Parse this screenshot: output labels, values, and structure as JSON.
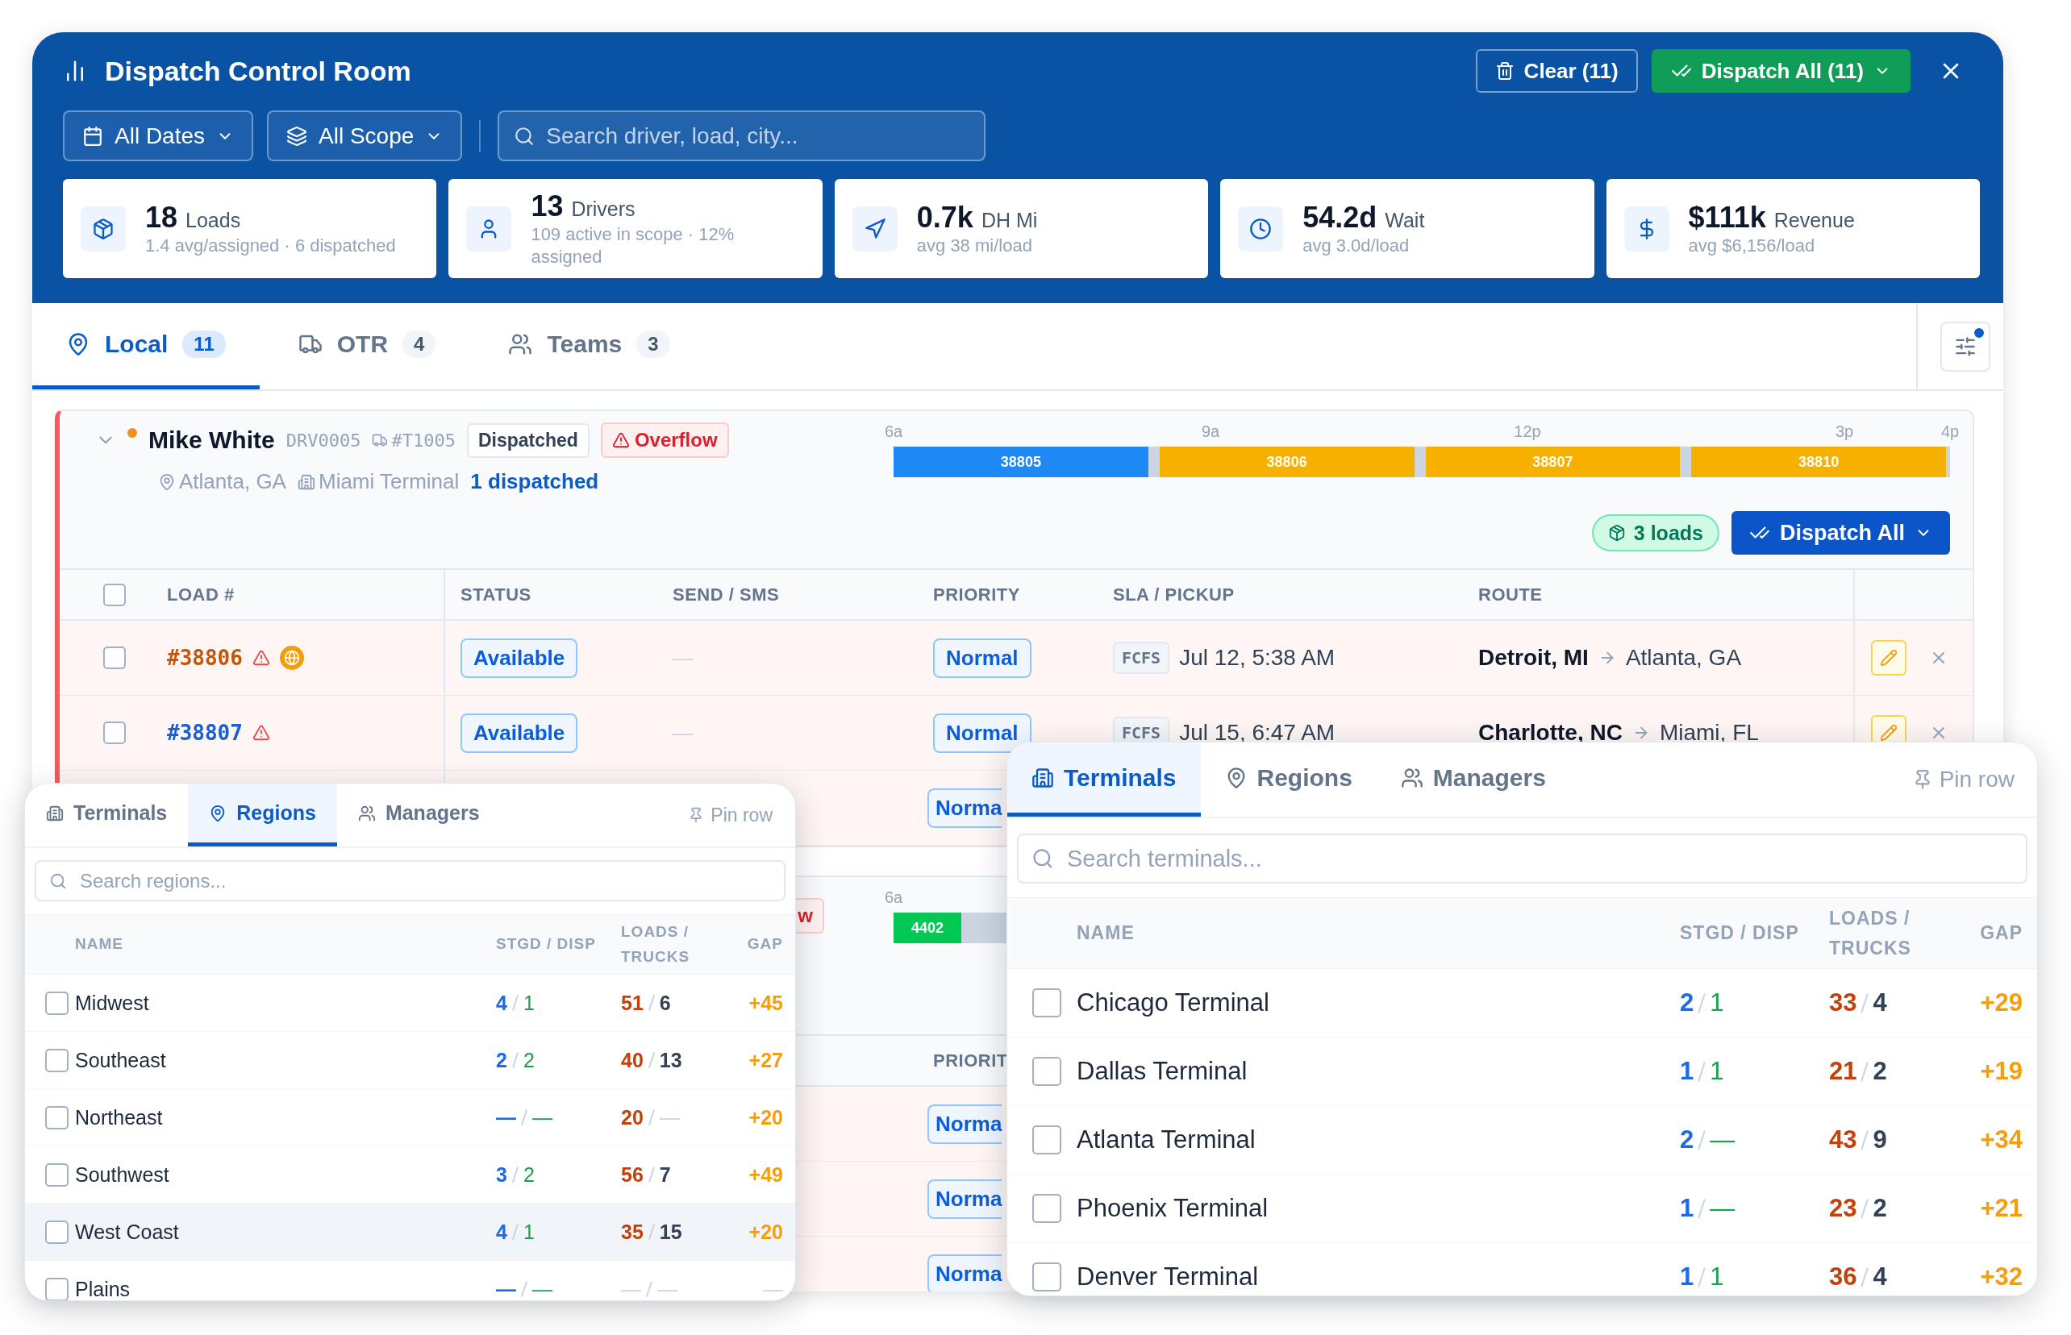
{
  "window": {
    "title": "Dispatch Control Room",
    "actions": [
      {
        "kind": "clear",
        "label": "Clear (11)"
      },
      {
        "kind": "dispatch",
        "label": "Dispatch All (11)"
      }
    ]
  },
  "filters": [
    {
      "kind": "dates",
      "label": "All Dates"
    },
    {
      "kind": "scope",
      "label": "All Scope"
    }
  ],
  "search": {
    "placeholder": "Search driver, load, city..."
  },
  "stats": [
    {
      "kind": "loads",
      "value": "18",
      "label": "Loads",
      "sub": "1.4 avg/assigned · 6 dispatched"
    },
    {
      "kind": "drivers",
      "value": "13",
      "label": "Drivers",
      "sub": "109 active in scope · 12% assigned"
    },
    {
      "kind": "deadhead",
      "value": "0.7k",
      "label": "DH Mi",
      "sub": "avg 38 mi/load"
    },
    {
      "kind": "wait",
      "value": "54.2d",
      "label": "Wait",
      "sub": "avg 3.0d/load"
    },
    {
      "kind": "revenue",
      "value": "$111k",
      "label": "Revenue",
      "sub": "avg $6,156/load"
    }
  ],
  "tabs": [
    {
      "kind": "local",
      "label": "Local",
      "count": "11",
      "selected": true
    },
    {
      "kind": "otr",
      "label": "OTR",
      "count": "4",
      "selected": false
    },
    {
      "kind": "teams",
      "label": "Teams",
      "count": "3",
      "selected": false
    }
  ],
  "drivers": [
    {
      "expanded": true,
      "color": "#f5901e",
      "name": "Mike White",
      "id": "DRV0005",
      "truck": "#T1005",
      "status": "Dispatched",
      "alert": "Overflow",
      "alert_icon": true,
      "location": "Atlanta, GA",
      "terminal": "Miami Terminal",
      "dispatched": "1 dispatched",
      "timeline": {
        "ticks": [
          "6a",
          "9a",
          "12p",
          "3p",
          "4p"
        ],
        "loads": [
          {
            "label": "38805",
            "kind": "long",
            "color": "#1e88f5"
          },
          {
            "label": "38806",
            "kind": "long",
            "color": "#f5b000"
          },
          {
            "label": "38807",
            "kind": "long",
            "color": "#f5b000"
          },
          {
            "label": "38810",
            "kind": "long",
            "color": "#f5b000"
          }
        ]
      },
      "loads_count": "3 loads",
      "dispatch_button": "Dispatch All",
      "select_all": {
        "checked": false
      },
      "columns": [
        {
          "kind": "load",
          "label": "LOAD #"
        },
        {
          "kind": "status",
          "label": "STATUS"
        },
        {
          "kind": "sms",
          "label": "SEND / SMS"
        },
        {
          "kind": "priority",
          "label": "PRIORITY"
        },
        {
          "kind": "sla",
          "label": "SLA / PICKUP"
        },
        {
          "kind": "route",
          "label": "ROUTE"
        }
      ],
      "rows": [
        {
          "checked": false,
          "load": "#38806",
          "color": "#c2570c",
          "warning": true,
          "globe": true,
          "status": "Available",
          "sms": "—",
          "priority": "Normal",
          "sla": "FCFS",
          "pickup": "Jul 12, 5:38 AM",
          "origin": "Detroit, MI",
          "destination": "Atlanta, GA"
        },
        {
          "checked": false,
          "load": "#38807",
          "color": "#1a5fd0",
          "warning": true,
          "globe": false,
          "status": "Available",
          "sms": "—",
          "priority": "Normal",
          "sla": "FCFS",
          "pickup": "Jul 15, 6:47 AM",
          "origin": "Charlotte, NC",
          "destination": "Miami, FL"
        },
        {
          "priority": "Norma"
        }
      ]
    },
    {
      "alert": "w",
      "alert_icon": false,
      "timeline": {
        "ticks": [
          "6a"
        ],
        "loads": [
          {
            "label": "4402",
            "kind": "short",
            "color": "#00c853"
          }
        ]
      },
      "columns": [
        {
          "kind": "priority",
          "label": "PRIORIT"
        }
      ],
      "rows": [
        {
          "priority": "Norma"
        },
        {
          "priority": "Norma"
        },
        {
          "priority": "Norma"
        }
      ]
    }
  ],
  "panels": [
    {
      "tabs": [
        {
          "kind": "terminals",
          "label": "Terminals",
          "selected": false
        },
        {
          "kind": "regions",
          "label": "Regions",
          "selected": true
        },
        {
          "kind": "managers",
          "label": "Managers",
          "selected": false
        }
      ],
      "pin": "Pin row",
      "search": {
        "placeholder": "Search regions..."
      },
      "columns": [
        "NAME",
        "STGD / DISP",
        "LOADS / TRUCKS",
        "GAP"
      ],
      "rows": [
        {
          "name": "Midwest",
          "checked": false,
          "highlighted": false,
          "stgd": "4",
          "disp": "1",
          "loads": "51",
          "loads_muted": false,
          "trucks": "6",
          "trucks_muted": false,
          "gap": "+45",
          "gap_muted": false
        },
        {
          "name": "Southeast",
          "checked": false,
          "highlighted": false,
          "stgd": "2",
          "disp": "2",
          "loads": "40",
          "loads_muted": false,
          "trucks": "13",
          "trucks_muted": false,
          "gap": "+27",
          "gap_muted": false
        },
        {
          "name": "Northeast",
          "checked": false,
          "highlighted": false,
          "stgd": "—",
          "disp": "—",
          "loads": "20",
          "loads_muted": false,
          "trucks": "—",
          "trucks_muted": true,
          "gap": "+20",
          "gap_muted": false
        },
        {
          "name": "Southwest",
          "checked": false,
          "highlighted": false,
          "stgd": "3",
          "disp": "2",
          "loads": "56",
          "loads_muted": false,
          "trucks": "7",
          "trucks_muted": false,
          "gap": "+49",
          "gap_muted": false
        },
        {
          "name": "West Coast",
          "checked": false,
          "highlighted": true,
          "stgd": "4",
          "disp": "1",
          "loads": "35",
          "loads_muted": false,
          "trucks": "15",
          "trucks_muted": false,
          "gap": "+20",
          "gap_muted": false
        },
        {
          "name": "Plains",
          "checked": false,
          "highlighted": false,
          "stgd": "—",
          "disp": "—",
          "loads": "—",
          "loads_muted": true,
          "trucks": "—",
          "trucks_muted": true,
          "gap": "—",
          "gap_muted": true
        }
      ]
    },
    {
      "tabs": [
        {
          "kind": "terminals",
          "label": "Terminals",
          "selected": true
        },
        {
          "kind": "regions",
          "label": "Regions",
          "selected": false
        },
        {
          "kind": "managers",
          "label": "Managers",
          "selected": false
        }
      ],
      "pin": "Pin row",
      "search": {
        "placeholder": "Search terminals..."
      },
      "columns": [
        "NAME",
        "STGD / DISP",
        "LOADS / TRUCKS",
        "GAP"
      ],
      "rows": [
        {
          "name": "Chicago Terminal",
          "checked": false,
          "highlighted": false,
          "stgd": "2",
          "disp": "1",
          "loads": "33",
          "loads_muted": false,
          "trucks": "4",
          "trucks_muted": false,
          "gap": "+29",
          "gap_muted": false
        },
        {
          "name": "Dallas Terminal",
          "checked": false,
          "highlighted": false,
          "stgd": "1",
          "disp": "1",
          "loads": "21",
          "loads_muted": false,
          "trucks": "2",
          "trucks_muted": false,
          "gap": "+19",
          "gap_muted": false
        },
        {
          "name": "Atlanta Terminal",
          "checked": false,
          "highlighted": false,
          "stgd": "2",
          "disp": "—",
          "loads": "43",
          "loads_muted": false,
          "trucks": "9",
          "trucks_muted": false,
          "gap": "+34",
          "gap_muted": false
        },
        {
          "name": "Phoenix Terminal",
          "checked": false,
          "highlighted": false,
          "stgd": "1",
          "disp": "—",
          "loads": "23",
          "loads_muted": false,
          "trucks": "2",
          "trucks_muted": false,
          "gap": "+21",
          "gap_muted": false
        },
        {
          "name": "Denver Terminal",
          "checked": false,
          "highlighted": false,
          "stgd": "1",
          "disp": "1",
          "loads": "36",
          "loads_muted": false,
          "trucks": "4",
          "trucks_muted": false,
          "gap": "+32",
          "gap_muted": false
        }
      ]
    }
  ]
}
